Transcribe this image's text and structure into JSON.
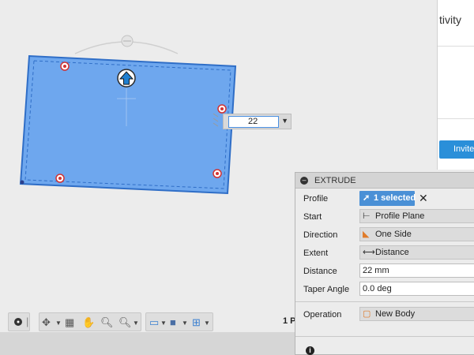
{
  "activity_panel": {
    "heading": "tivity",
    "invite_button": "Invite"
  },
  "viewport": {
    "dimension_value": "22",
    "status_text": "1 P"
  },
  "toolbar": {
    "icons": [
      "display-settings-icon",
      "orbit-icon",
      "look-at-icon",
      "pan-icon",
      "zoom-icon",
      "fit-icon",
      "display-mode-icon",
      "visual-style-icon",
      "grid-icon"
    ]
  },
  "extrude": {
    "title": "EXTRUDE",
    "rows": {
      "profile": {
        "label": "Profile",
        "value": "1 selected"
      },
      "start": {
        "label": "Start",
        "value": "Profile Plane"
      },
      "direction": {
        "label": "Direction",
        "value": "One Side"
      },
      "extent": {
        "label": "Extent",
        "value": "Distance"
      },
      "distance": {
        "label": "Distance",
        "value": "22 mm"
      },
      "taper": {
        "label": "Taper Angle",
        "value": "0.0 deg"
      },
      "operation": {
        "label": "Operation",
        "value": "New Body"
      }
    }
  },
  "colors": {
    "profile_fill": "#6ea7ee",
    "profile_stroke": "#2f6ec7",
    "selection_blue": "#4a90d6",
    "invite_blue": "#2a8fd9"
  }
}
